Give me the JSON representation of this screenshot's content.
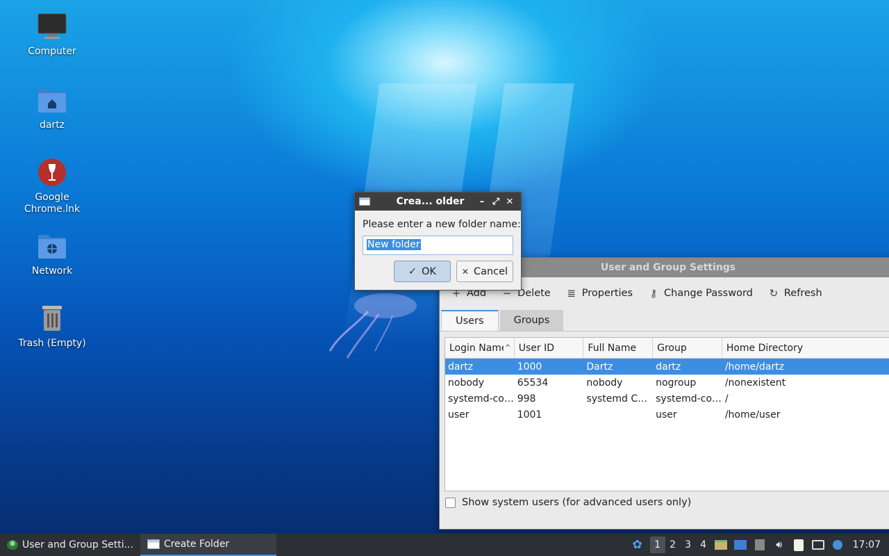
{
  "desktop": {
    "icons": [
      {
        "label": "Computer",
        "icon": "monitor-icon"
      },
      {
        "label": "dartz",
        "icon": "home-folder-icon"
      },
      {
        "label": "Google Chrome.lnk",
        "icon": "wine-glass-icon"
      },
      {
        "label": "Network",
        "icon": "network-folder-icon"
      },
      {
        "label": "Trash (Empty)",
        "icon": "trash-icon"
      }
    ]
  },
  "dialog": {
    "title": "Crea... older",
    "prompt": "Please enter a new folder name:",
    "input_value": "New folder",
    "ok_label": "OK",
    "cancel_label": "Cancel",
    "controls": {
      "minimize": "–",
      "maximize": "⤢",
      "close": "✕"
    }
  },
  "users_window": {
    "title": "User and Group Settings",
    "toolbar": {
      "add": "Add",
      "delete": "Delete",
      "properties": "Properties",
      "change_password": "Change Password",
      "refresh": "Refresh"
    },
    "tabs": [
      "Users",
      "Groups"
    ],
    "columns": [
      "Login Name",
      "User ID",
      "Full Name",
      "Group",
      "Home Directory"
    ],
    "rows": [
      {
        "login": "dartz",
        "uid": "1000",
        "full_name": "Dartz",
        "group": "dartz",
        "home": "/home/dartz"
      },
      {
        "login": "nobody",
        "uid": "65534",
        "full_name": "nobody",
        "group": "nogroup",
        "home": "/nonexistent"
      },
      {
        "login": "systemd-co…",
        "uid": "998",
        "full_name": "systemd Co…",
        "group": "systemd-co…",
        "home": "/"
      },
      {
        "login": "user",
        "uid": "1001",
        "full_name": "",
        "group": "user",
        "home": "/home/user"
      }
    ],
    "show_system_users_label": "Show system users (for advanced users only)"
  },
  "taskbar": {
    "tasks": [
      {
        "label": "User and Group Setti...",
        "active": false
      },
      {
        "label": "Create Folder",
        "active": true
      }
    ],
    "workspaces": [
      "1",
      "2",
      "3",
      "4"
    ],
    "clock": "17:07"
  },
  "colors": {
    "selection": "#3d8ee3",
    "taskbar_bg": "#2c2f34",
    "dialog_title_bg": "#3e3e3e"
  }
}
